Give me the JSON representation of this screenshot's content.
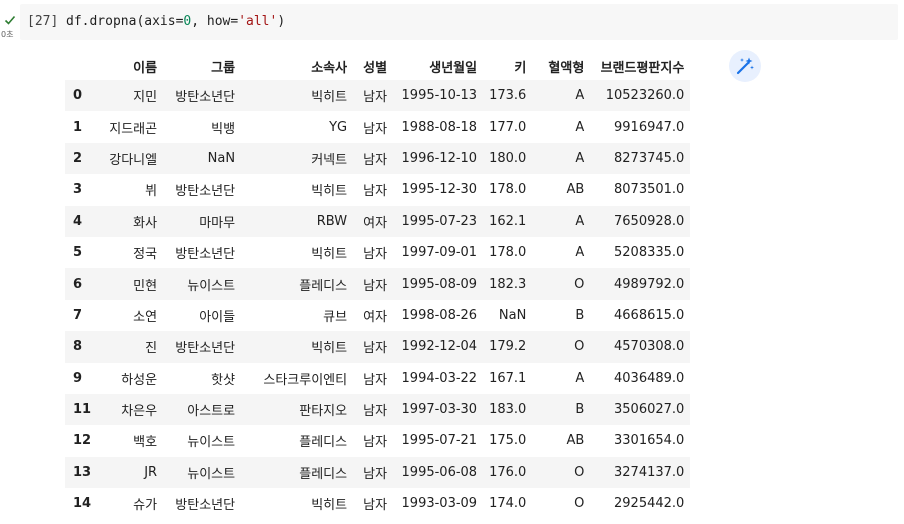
{
  "cell": {
    "exec_count": "[27]",
    "exec_time": "0초",
    "code": {
      "p1": "df.dropna(axis=",
      "p2": "0",
      "p3": ", how=",
      "p4": "'all'",
      "p5": ")"
    }
  },
  "table": {
    "headers": [
      "",
      "이름",
      "그룹",
      "소속사",
      "성별",
      "생년월일",
      "키",
      "혈액형",
      "브랜드평판지수"
    ],
    "rows": [
      [
        "0",
        "지민",
        "방탄소년단",
        "빅히트",
        "남자",
        "1995-10-13",
        "173.6",
        "A",
        "10523260.0"
      ],
      [
        "1",
        "지드래곤",
        "빅뱅",
        "YG",
        "남자",
        "1988-08-18",
        "177.0",
        "A",
        "9916947.0"
      ],
      [
        "2",
        "강다니엘",
        "NaN",
        "커넥트",
        "남자",
        "1996-12-10",
        "180.0",
        "A",
        "8273745.0"
      ],
      [
        "3",
        "뷔",
        "방탄소년단",
        "빅히트",
        "남자",
        "1995-12-30",
        "178.0",
        "AB",
        "8073501.0"
      ],
      [
        "4",
        "화사",
        "마마무",
        "RBW",
        "여자",
        "1995-07-23",
        "162.1",
        "A",
        "7650928.0"
      ],
      [
        "5",
        "정국",
        "방탄소년단",
        "빅히트",
        "남자",
        "1997-09-01",
        "178.0",
        "A",
        "5208335.0"
      ],
      [
        "6",
        "민현",
        "뉴이스트",
        "플레디스",
        "남자",
        "1995-08-09",
        "182.3",
        "O",
        "4989792.0"
      ],
      [
        "7",
        "소연",
        "아이들",
        "큐브",
        "여자",
        "1998-08-26",
        "NaN",
        "B",
        "4668615.0"
      ],
      [
        "8",
        "진",
        "방탄소년단",
        "빅히트",
        "남자",
        "1992-12-04",
        "179.2",
        "O",
        "4570308.0"
      ],
      [
        "9",
        "하성운",
        "핫샷",
        "스타크루이엔티",
        "남자",
        "1994-03-22",
        "167.1",
        "A",
        "4036489.0"
      ],
      [
        "11",
        "차은우",
        "아스트로",
        "판타지오",
        "남자",
        "1997-03-30",
        "183.0",
        "B",
        "3506027.0"
      ],
      [
        "12",
        "백호",
        "뉴이스트",
        "플레디스",
        "남자",
        "1995-07-21",
        "175.0",
        "AB",
        "3301654.0"
      ],
      [
        "13",
        "JR",
        "뉴이스트",
        "플레디스",
        "남자",
        "1995-06-08",
        "176.0",
        "O",
        "3274137.0"
      ],
      [
        "14",
        "슈가",
        "방탄소년단",
        "빅히트",
        "남자",
        "1993-03-09",
        "174.0",
        "O",
        "2925442.0"
      ]
    ]
  },
  "icons": {
    "check": "check-icon",
    "magic": "magic-wand-icon"
  },
  "colors": {
    "check": "#2e7d32",
    "magic": "#1a73e8"
  }
}
